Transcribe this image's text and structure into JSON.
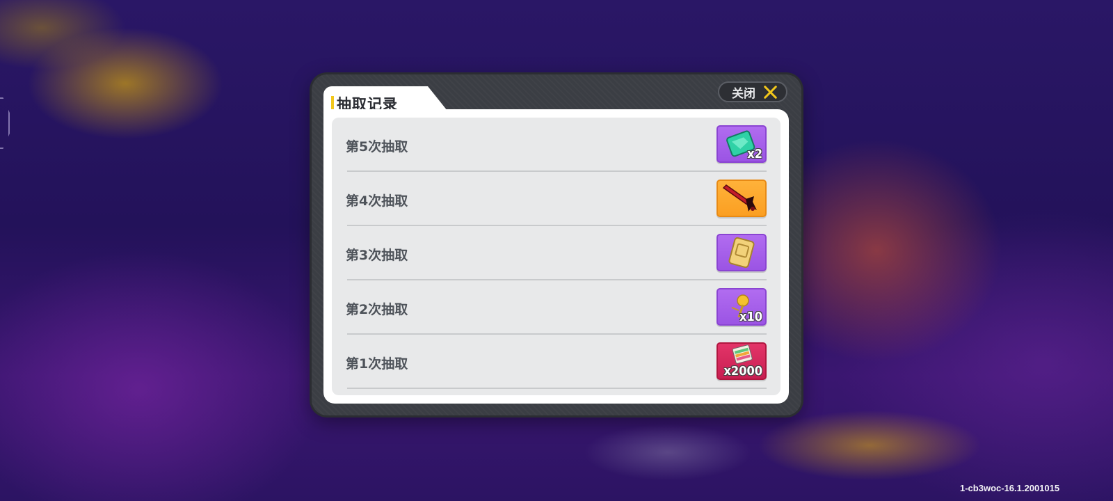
{
  "dialog": {
    "title": "抽取记录",
    "close_label": "关闭"
  },
  "records": [
    {
      "label": "第5次抽取",
      "item_icon": "green-crystal-icon",
      "item_qty": "x2",
      "frame_color": "purple"
    },
    {
      "label": "第4次抽取",
      "item_icon": "red-sword-icon",
      "item_qty": "",
      "frame_color": "orange"
    },
    {
      "label": "第3次抽取",
      "item_icon": "gold-ticket-icon",
      "item_qty": "",
      "frame_color": "purple"
    },
    {
      "label": "第2次抽取",
      "item_icon": "gold-flower-icon",
      "item_qty": "x10",
      "frame_color": "purple"
    },
    {
      "label": "第1次抽取",
      "item_icon": "cards-stack-icon",
      "item_qty": "x2000",
      "frame_color": "red"
    }
  ],
  "version": "1-cb3woc-16.1.2001015",
  "colors": {
    "accent_yellow": "#f2c71b",
    "frame_purple": "#9b54e4",
    "frame_orange": "#fb9f22",
    "frame_red": "#c81f52"
  }
}
